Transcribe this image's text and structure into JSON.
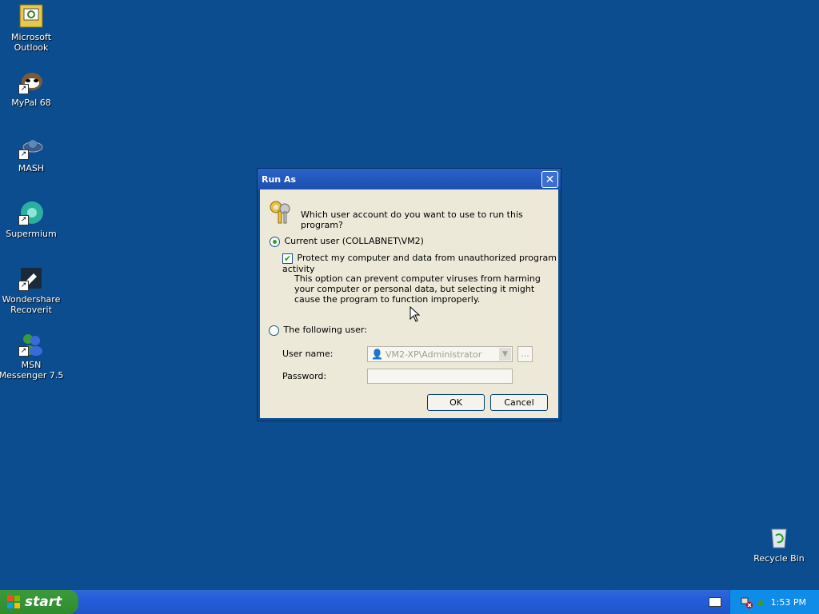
{
  "desktop": {
    "icons": [
      {
        "label": "Microsoft Outlook",
        "icon": "outlook-icon"
      },
      {
        "label": "MyPal 68",
        "icon": "mypal-icon"
      },
      {
        "label": "MASH",
        "icon": "mash-icon"
      },
      {
        "label": "Supermium",
        "icon": "supermium-icon"
      },
      {
        "label": "Wondershare Recoverit",
        "icon": "recoverit-icon"
      },
      {
        "label": "MSN Messenger 7.5",
        "icon": "msn-icon"
      },
      {
        "label": "Recycle Bin",
        "icon": "recycle-bin-icon"
      }
    ]
  },
  "dialog": {
    "title": "Run As",
    "question": "Which user account do you want to use to run this program?",
    "current_user_label": "Current user (COLLABNET\\VM2)",
    "protect_label": "Protect my computer and data from unauthorized program activity",
    "protect_description": "This option can prevent computer viruses from harming your computer or personal data, but selecting it might cause the program to function improperly.",
    "following_user_label": "The following user:",
    "username_label": "User name:",
    "username_value": "VM2-XP\\Administrator",
    "browse_label": "...",
    "password_label": "Password:",
    "ok_label": "OK",
    "cancel_label": "Cancel",
    "current_user_selected": true,
    "protect_checked": true
  },
  "taskbar": {
    "start_label": "start",
    "clock": "1:53 PM"
  },
  "colors": {
    "desktop": "#0b4d8f",
    "titlebar": "#2a63c9",
    "dialog_bg": "#ece9d8"
  }
}
